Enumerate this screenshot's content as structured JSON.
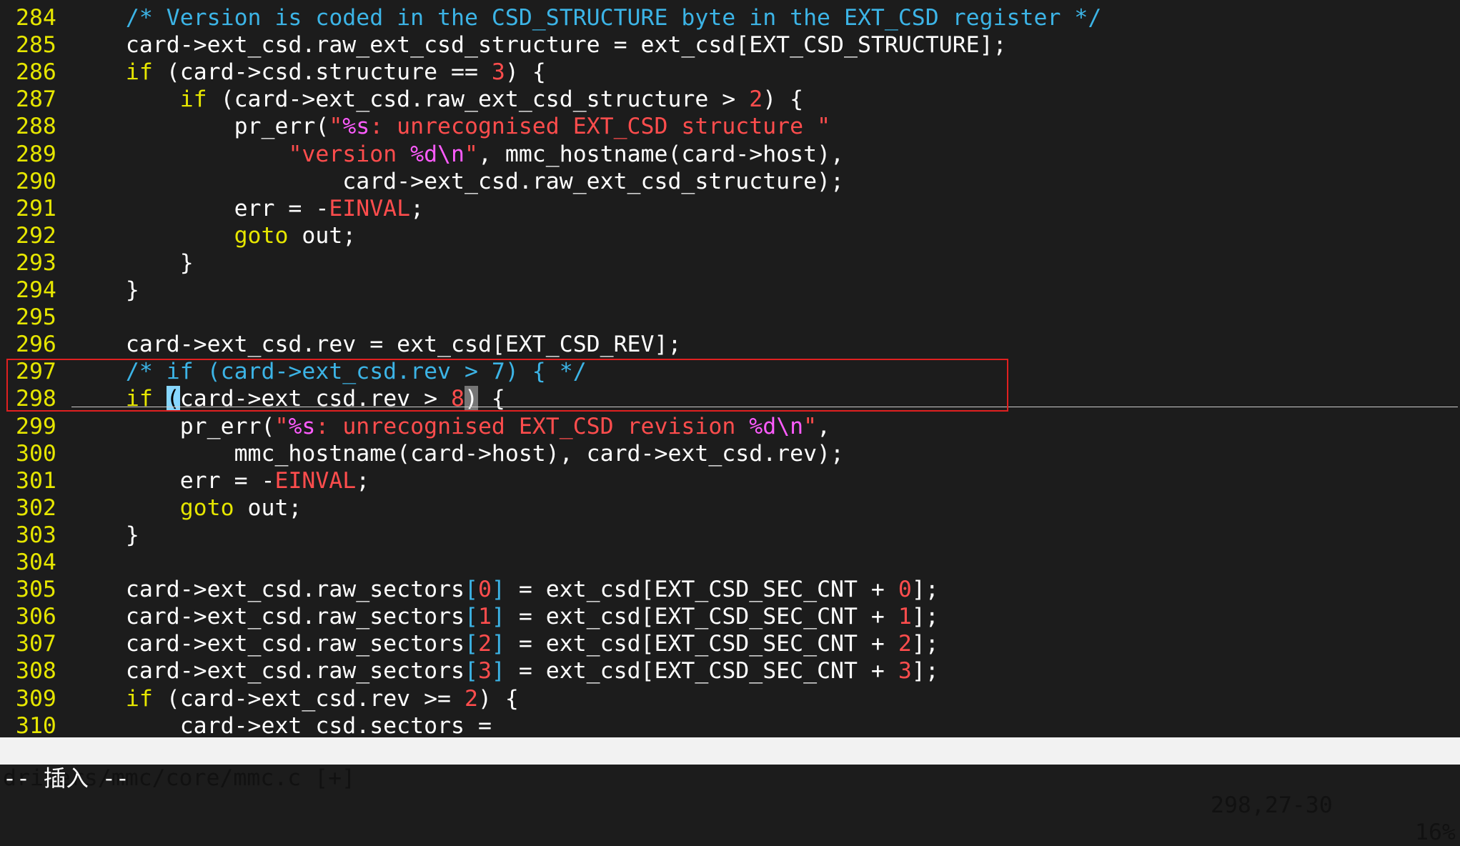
{
  "editor": {
    "lines": [
      {
        "num": "284",
        "tokens": [
          {
            "t": "    "
          },
          {
            "t": "/* Version is coded in the CSD_STRUCTURE byte in the EXT_CSD register */",
            "c": "comment"
          }
        ]
      },
      {
        "num": "285",
        "tokens": [
          {
            "t": "    card->ext_csd.raw_ext_csd_structure = ext_csd[EXT_CSD_STRUCTURE];"
          }
        ]
      },
      {
        "num": "286",
        "tokens": [
          {
            "t": "    "
          },
          {
            "t": "if",
            "c": "keyword"
          },
          {
            "t": " (card->csd.structure == "
          },
          {
            "t": "3",
            "c": "number"
          },
          {
            "t": ") {"
          }
        ]
      },
      {
        "num": "287",
        "tokens": [
          {
            "t": "        "
          },
          {
            "t": "if",
            "c": "keyword"
          },
          {
            "t": " (card->ext_csd.raw_ext_csd_structure > "
          },
          {
            "t": "2",
            "c": "number"
          },
          {
            "t": ") {"
          }
        ]
      },
      {
        "num": "288",
        "tokens": [
          {
            "t": "            pr_err("
          },
          {
            "t": "\"",
            "c": "string"
          },
          {
            "t": "%s",
            "c": "format"
          },
          {
            "t": ": unrecognised EXT_CSD structure \"",
            "c": "string"
          }
        ]
      },
      {
        "num": "289",
        "tokens": [
          {
            "t": "                "
          },
          {
            "t": "\"version ",
            "c": "string"
          },
          {
            "t": "%d\\n",
            "c": "format"
          },
          {
            "t": "\"",
            "c": "string"
          },
          {
            "t": ", mmc_hostname(card->host),"
          }
        ]
      },
      {
        "num": "290",
        "tokens": [
          {
            "t": "                    card->ext_csd.raw_ext_csd_structure);"
          }
        ]
      },
      {
        "num": "291",
        "tokens": [
          {
            "t": "            err = -"
          },
          {
            "t": "EINVAL",
            "c": "string"
          },
          {
            "t": ";"
          }
        ]
      },
      {
        "num": "292",
        "tokens": [
          {
            "t": "            "
          },
          {
            "t": "goto",
            "c": "keyword"
          },
          {
            "t": " out;"
          }
        ]
      },
      {
        "num": "293",
        "tokens": [
          {
            "t": "        }"
          }
        ]
      },
      {
        "num": "294",
        "tokens": [
          {
            "t": "    }"
          }
        ]
      },
      {
        "num": "295",
        "tokens": []
      },
      {
        "num": "296",
        "tokens": [
          {
            "t": "    card->ext_csd.rev = ext_csd[EXT_CSD_REV];"
          }
        ]
      },
      {
        "num": "297",
        "tokens": [
          {
            "t": "    "
          },
          {
            "t": "/* if (card->ext_csd.rev > 7) { */",
            "c": "comment"
          }
        ]
      },
      {
        "num": "298",
        "tokens": [
          {
            "t": "    "
          },
          {
            "t": "if",
            "c": "keyword"
          },
          {
            "t": " "
          },
          {
            "t": "(",
            "c": "cursor"
          },
          {
            "t": "card->ext_csd.rev > "
          },
          {
            "t": "8",
            "c": "number"
          },
          {
            "t": ")",
            "c": "match"
          },
          {
            "t": " {"
          }
        ]
      },
      {
        "num": "299",
        "tokens": [
          {
            "t": "        pr_err("
          },
          {
            "t": "\"",
            "c": "string"
          },
          {
            "t": "%s",
            "c": "format"
          },
          {
            "t": ": unrecognised EXT_CSD revision ",
            "c": "string"
          },
          {
            "t": "%d\\n",
            "c": "format"
          },
          {
            "t": "\"",
            "c": "string"
          },
          {
            "t": ","
          }
        ]
      },
      {
        "num": "300",
        "tokens": [
          {
            "t": "            mmc_hostname(card->host), card->ext_csd.rev);"
          }
        ]
      },
      {
        "num": "301",
        "tokens": [
          {
            "t": "        err = -"
          },
          {
            "t": "EINVAL",
            "c": "string"
          },
          {
            "t": ";"
          }
        ]
      },
      {
        "num": "302",
        "tokens": [
          {
            "t": "        "
          },
          {
            "t": "goto",
            "c": "keyword"
          },
          {
            "t": " out;"
          }
        ]
      },
      {
        "num": "303",
        "tokens": [
          {
            "t": "    }"
          }
        ]
      },
      {
        "num": "304",
        "tokens": []
      },
      {
        "num": "305",
        "tokens": [
          {
            "t": "    card->ext_csd.raw_sectors"
          },
          {
            "t": "[",
            "c": "bracket"
          },
          {
            "t": "0",
            "c": "number"
          },
          {
            "t": "]",
            "c": "bracket"
          },
          {
            "t": " = ext_csd[EXT_CSD_SEC_CNT + "
          },
          {
            "t": "0",
            "c": "number"
          },
          {
            "t": "];"
          }
        ]
      },
      {
        "num": "306",
        "tokens": [
          {
            "t": "    card->ext_csd.raw_sectors"
          },
          {
            "t": "[",
            "c": "bracket"
          },
          {
            "t": "1",
            "c": "number"
          },
          {
            "t": "]",
            "c": "bracket"
          },
          {
            "t": " = ext_csd[EXT_CSD_SEC_CNT + "
          },
          {
            "t": "1",
            "c": "number"
          },
          {
            "t": "];"
          }
        ]
      },
      {
        "num": "307",
        "tokens": [
          {
            "t": "    card->ext_csd.raw_sectors"
          },
          {
            "t": "[",
            "c": "bracket"
          },
          {
            "t": "2",
            "c": "number"
          },
          {
            "t": "]",
            "c": "bracket"
          },
          {
            "t": " = ext_csd[EXT_CSD_SEC_CNT + "
          },
          {
            "t": "2",
            "c": "number"
          },
          {
            "t": "];"
          }
        ]
      },
      {
        "num": "308",
        "tokens": [
          {
            "t": "    card->ext_csd.raw_sectors"
          },
          {
            "t": "[",
            "c": "bracket"
          },
          {
            "t": "3",
            "c": "number"
          },
          {
            "t": "]",
            "c": "bracket"
          },
          {
            "t": " = ext_csd[EXT_CSD_SEC_CNT + "
          },
          {
            "t": "3",
            "c": "number"
          },
          {
            "t": "];"
          }
        ]
      },
      {
        "num": "309",
        "tokens": [
          {
            "t": "    "
          },
          {
            "t": "if",
            "c": "keyword"
          },
          {
            "t": " (card->ext_csd.rev >= "
          },
          {
            "t": "2",
            "c": "number"
          },
          {
            "t": ") {"
          }
        ]
      },
      {
        "num": "310",
        "tokens": [
          {
            "t": "        card->ext_csd.sectors ="
          }
        ]
      }
    ]
  },
  "status": {
    "file": "drivers/mmc/core/mmc.c [+]",
    "position": "298,27-30",
    "percent": "16%"
  },
  "mode": "-- 插入 --",
  "colors": {
    "background": "#1c1c1c",
    "line_number": "#e6e600",
    "comment": "#3cb4e6",
    "keyword": "#e6e600",
    "string": "#ff4d4d",
    "format": "#ff5cff",
    "highlight_box": "#e02020"
  }
}
